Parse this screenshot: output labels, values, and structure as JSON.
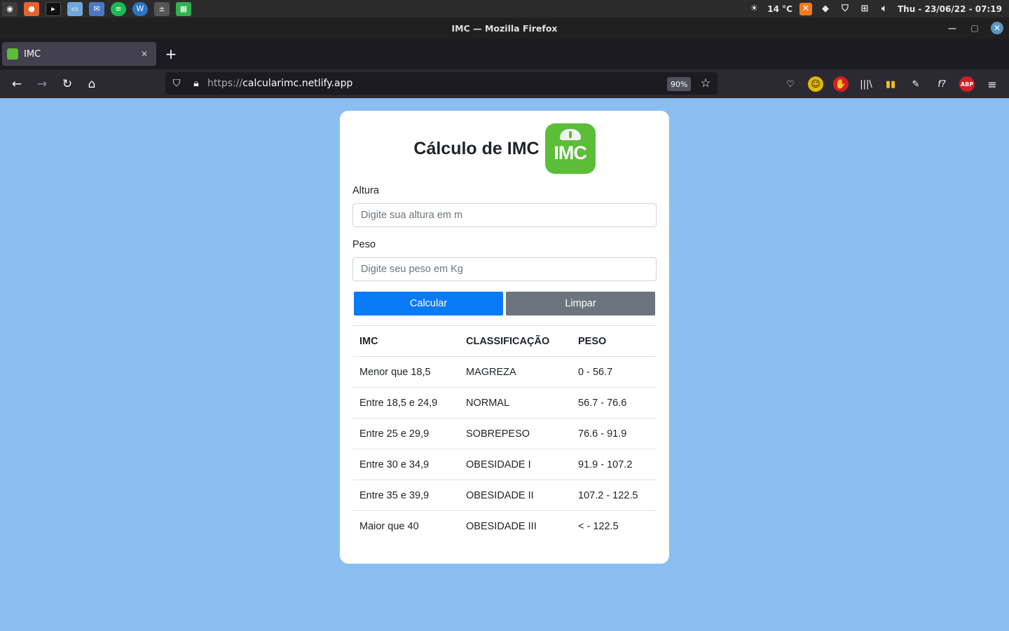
{
  "os_panel": {
    "weather": "14 °C",
    "datetime": "Thu - 23/06/22 - 07:19"
  },
  "window": {
    "title": "IMC — Mozilla Firefox"
  },
  "tabs": [
    {
      "label": "IMC",
      "active": true
    }
  ],
  "navbar": {
    "url_scheme": "https://",
    "url_host": "calcularimc.netlify.app",
    "zoom": "90%"
  },
  "page": {
    "title": "Cálculo de IMC",
    "logo_text": "IMC",
    "altura_label": "Altura",
    "altura_placeholder": "Digite sua altura em m",
    "peso_label": "Peso",
    "peso_placeholder": "Digite seu peso em Kg",
    "calcular_label": "Calcular",
    "limpar_label": "Limpar",
    "table": {
      "headers": [
        "IMC",
        "CLASSIFICAÇÃO",
        "PESO"
      ],
      "rows": [
        [
          "Menor que 18,5",
          "MAGREZA",
          "0 - 56.7"
        ],
        [
          "Entre 18,5 e 24,9",
          "NORMAL",
          "56.7 - 76.6"
        ],
        [
          "Entre 25 e 29,9",
          "SOBREPESO",
          "76.6 - 91.9"
        ],
        [
          "Entre 30 e 34,9",
          "OBESIDADE I",
          "91.9 - 107.2"
        ],
        [
          "Entre 35 e 39,9",
          "OBESIDADE II",
          "107.2 - 122.5"
        ],
        [
          "Maior que 40",
          "OBESIDADE III",
          "< - 122.5"
        ]
      ]
    }
  },
  "colors": {
    "page_background": "#8bbef0",
    "primary_button": "#0b7af8",
    "secondary_button": "#6c757d",
    "logo_green": "#5bbd38"
  }
}
